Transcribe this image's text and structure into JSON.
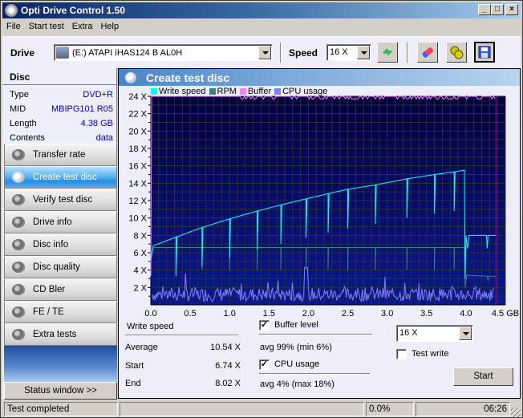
{
  "window": {
    "title": "Opti Drive Control 1.50",
    "minimize": "_",
    "maximize": "□",
    "close": "×"
  },
  "menu": [
    "File",
    "Start test",
    "Extra",
    "Help"
  ],
  "toolbar": {
    "drive_label": "Drive",
    "drive_value": "(E:)  ATAPI iHAS124   B AL0H",
    "speed_label": "Speed",
    "speed_value": "16 X",
    "buttons": [
      "refresh-icon",
      "eraser-icon",
      "disc-settings-icon",
      "save-icon"
    ]
  },
  "disc": {
    "title": "Disc",
    "rows": [
      {
        "label": "Type",
        "value": "DVD+R"
      },
      {
        "label": "MID",
        "value": "MBIPG101 R05"
      },
      {
        "label": "Length",
        "value": "4.38 GB"
      },
      {
        "label": "Contents",
        "value": "data"
      }
    ]
  },
  "nav": [
    {
      "label": "Transfer rate",
      "active": false
    },
    {
      "label": "Create test disc",
      "active": true
    },
    {
      "label": "Verify test disc",
      "active": false
    },
    {
      "label": "Drive info",
      "active": false
    },
    {
      "label": "Disc info",
      "active": false
    },
    {
      "label": "Disc quality",
      "active": false
    },
    {
      "label": "CD Bler",
      "active": false
    },
    {
      "label": "FE / TE",
      "active": false
    },
    {
      "label": "Extra tests",
      "active": false
    }
  ],
  "status_window_label": "Status window >>",
  "main": {
    "title": "Create test disc",
    "stats": {
      "section_title": "Write speed",
      "average_label": "Average",
      "average_value": "10.54 X",
      "start_label": "Start",
      "start_value": "6.74 X",
      "end_label": "End",
      "end_value": "8.02 X"
    },
    "buffer": {
      "label": "Buffer level",
      "checked": true,
      "summary": "avg 99% (min 6%)"
    },
    "cpu": {
      "label": "CPU usage",
      "checked": true,
      "summary": "avg 4% (max 18%)"
    },
    "speed_select": "16 X",
    "test_write": {
      "label": "Test write",
      "checked": false
    },
    "start_button": "Start"
  },
  "statusbar": {
    "message": "Test completed",
    "progress": "0.0%",
    "time": "06:26"
  },
  "chart_data": {
    "type": "line",
    "title": "",
    "xlabel": "GB",
    "ylabel": "",
    "xlim": [
      0,
      4.5
    ],
    "ylim": [
      0,
      24
    ],
    "x_ticks": [
      "0.0",
      "0.5",
      "1.0",
      "1.5",
      "2.0",
      "2.5",
      "3.0",
      "3.5",
      "4.0",
      "4.5 GB"
    ],
    "y_ticks": [
      "2 X",
      "4 X",
      "6 X",
      "8 X",
      "10 X",
      "12 X",
      "14 X",
      "16 X",
      "18 X",
      "20 X",
      "22 X",
      "24 X"
    ],
    "grid": true,
    "legend": [
      {
        "name": "Write speed",
        "color": "#00ffff"
      },
      {
        "name": "RPM",
        "color": "#408080"
      },
      {
        "name": "Buffer",
        "color": "#ff80ff"
      },
      {
        "name": "CPU usage",
        "color": "#8080ff"
      }
    ],
    "legend_position": "top-left",
    "series": [
      {
        "name": "Write speed",
        "points": [
          [
            0.0,
            5.2
          ],
          [
            0.03,
            6.8
          ],
          [
            0.32,
            7.8
          ],
          [
            0.65,
            8.9
          ],
          [
            1.0,
            9.9
          ],
          [
            1.35,
            10.8
          ],
          [
            1.65,
            11.5
          ],
          [
            1.97,
            12.2
          ],
          [
            2.25,
            12.8
          ],
          [
            2.5,
            13.3
          ],
          [
            2.85,
            13.8
          ],
          [
            3.25,
            14.5
          ],
          [
            3.6,
            15.0
          ],
          [
            3.85,
            15.3
          ],
          [
            3.98,
            15.5
          ],
          [
            4.0,
            8.0
          ],
          [
            4.38,
            8.0
          ]
        ],
        "dips_at": [
          0.32,
          0.65,
          1.0,
          1.35,
          1.65,
          1.97,
          2.25,
          2.5,
          2.85,
          3.25,
          3.6,
          3.85,
          4.02,
          4.27
        ]
      },
      {
        "name": "RPM",
        "points": [
          [
            0.0,
            6.6
          ],
          [
            3.98,
            6.6
          ],
          [
            4.0,
            3.4
          ],
          [
            4.38,
            3.3
          ]
        ]
      },
      {
        "name": "Buffer",
        "points": [
          [
            0.0,
            3.3
          ],
          [
            0.02,
            24.0
          ],
          [
            4.38,
            24.0
          ]
        ]
      },
      {
        "name": "CPU usage",
        "approx_range": [
          0,
          4.3
        ],
        "average": 1.0,
        "max": 4.3
      }
    ]
  }
}
